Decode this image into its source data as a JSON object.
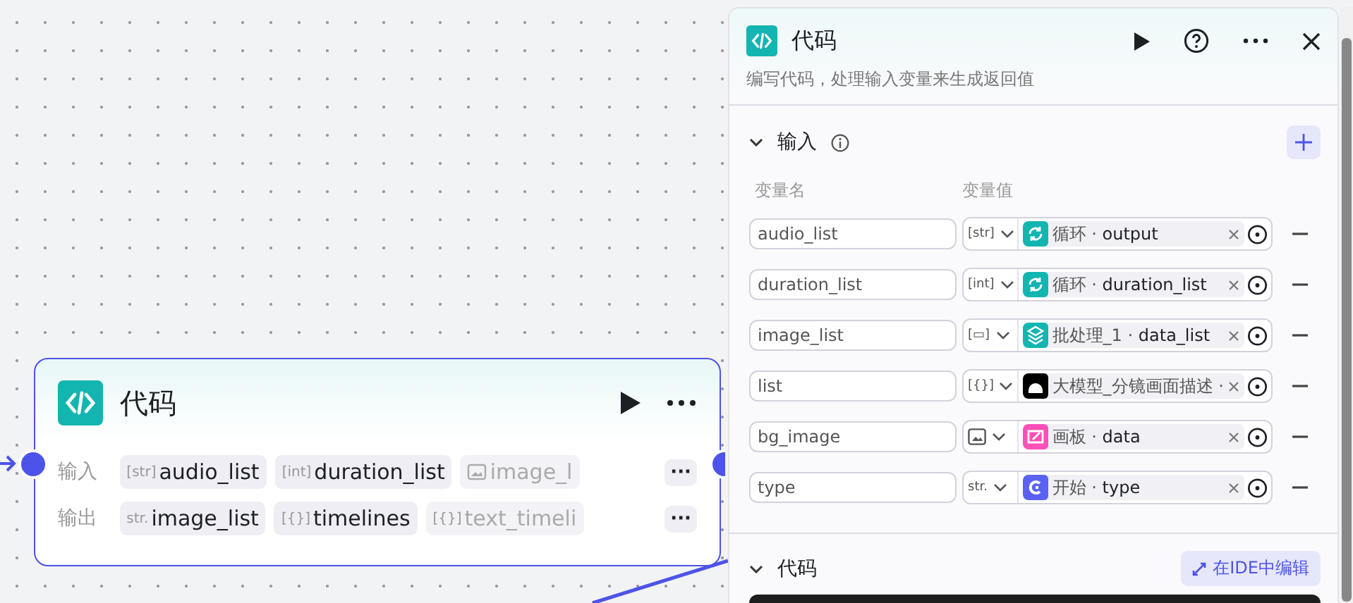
{
  "node": {
    "title": "代码",
    "inputs_label": "输入",
    "inputs": [
      {
        "type": {
          "kind": "text",
          "label": "[str]"
        },
        "name": "audio_list",
        "faded": false
      },
      {
        "type": {
          "kind": "text",
          "label": "[int]"
        },
        "name": "duration_list",
        "faded": false
      },
      {
        "type": {
          "kind": "image"
        },
        "name": "image_l",
        "faded": true
      }
    ],
    "outputs_label": "输出",
    "outputs": [
      {
        "type": {
          "kind": "text",
          "label": "str."
        },
        "name": "image_list",
        "faded": false
      },
      {
        "type": {
          "kind": "text",
          "label": "[{}]"
        },
        "name": "timelines",
        "faded": false
      },
      {
        "type": {
          "kind": "text",
          "label": "[{}]"
        },
        "name": "text_timeli",
        "faded": true
      }
    ],
    "more": "···"
  },
  "panel": {
    "title": "代码",
    "description": "编写代码，处理输入变量来生成返回值",
    "input_section": {
      "title": "输入",
      "expanded": true,
      "col_name": "变量名",
      "col_value": "变量值",
      "rows": [
        {
          "name": "audio_list",
          "type": {
            "kind": "text",
            "label": "[str]"
          },
          "source": {
            "kind": "loop",
            "color": "#13b5b1",
            "node": "循环",
            "separator": "·",
            "field": "output"
          }
        },
        {
          "name": "duration_list",
          "type": {
            "kind": "text",
            "label": "[int]"
          },
          "source": {
            "kind": "loop",
            "color": "#13b5b1",
            "node": "循环",
            "separator": "·",
            "field": "duration_list"
          }
        },
        {
          "name": "image_list",
          "type": {
            "kind": "text",
            "label": "[▭]"
          },
          "source": {
            "kind": "batch",
            "color": "#13b5b1",
            "node": "批处理_1",
            "separator": "·",
            "field": "data_list"
          }
        },
        {
          "name": "list",
          "type": {
            "kind": "text",
            "label": "[{}]"
          },
          "source": {
            "kind": "llm",
            "color": "#000000",
            "node": "大模型_分镜画面描述",
            "separator": "·"
          }
        },
        {
          "name": "bg_image",
          "type": {
            "kind": "image"
          },
          "source": {
            "kind": "canvas",
            "color": "#ff4fb8",
            "node": "画板",
            "separator": "·",
            "field": "data"
          }
        },
        {
          "name": "type",
          "type": {
            "kind": "text",
            "label": "str."
          },
          "source": {
            "kind": "start",
            "color": "#5a62f4",
            "node": "开始",
            "separator": "·",
            "field": "type"
          }
        }
      ]
    },
    "code_section": {
      "title": "代码",
      "expanded": true,
      "ide_button": "在IDE中编辑"
    }
  }
}
